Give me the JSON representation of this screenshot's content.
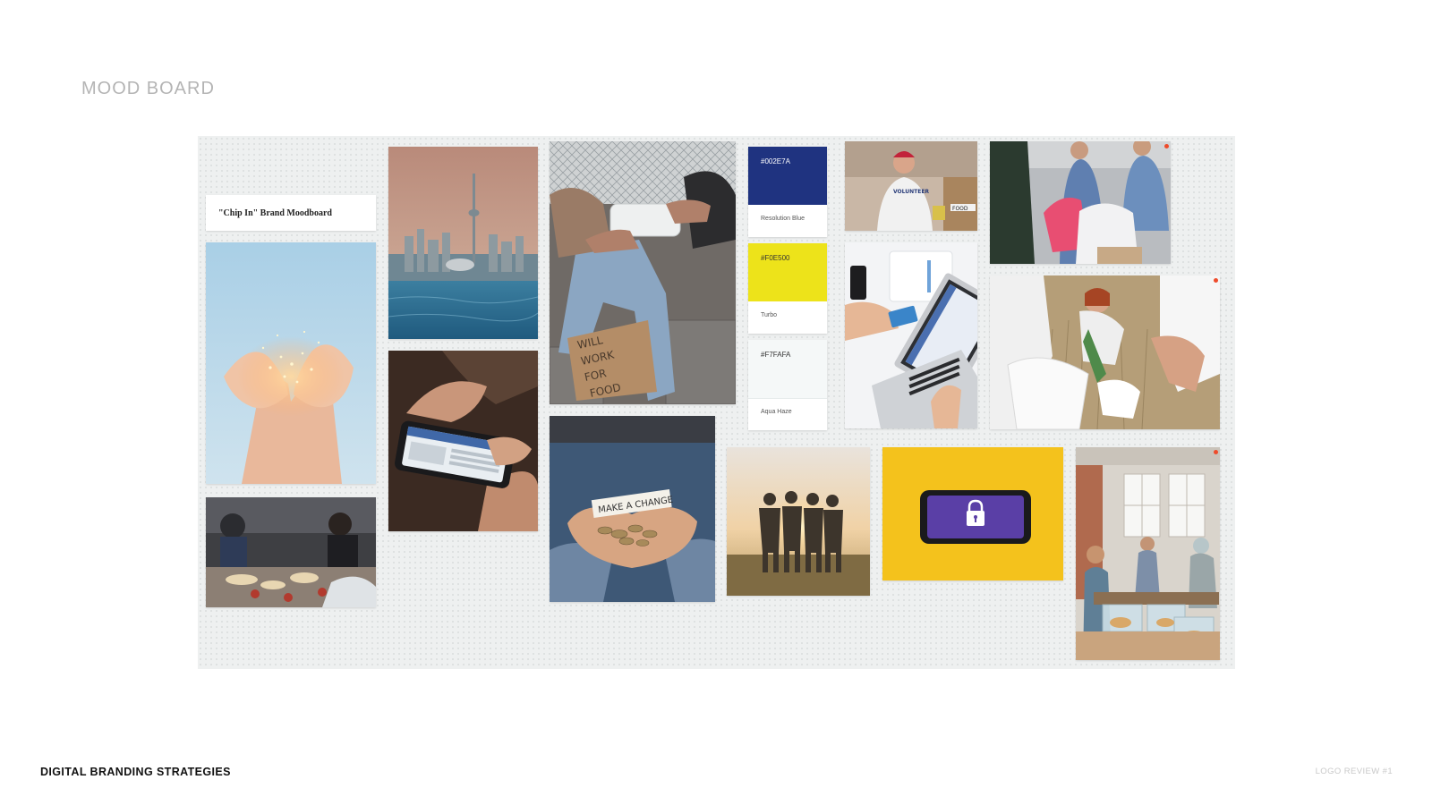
{
  "slide": {
    "title": "MOOD BOARD",
    "footer_left": "DIGITAL BRANDING STRATEGIES",
    "footer_right": "LOGO REVIEW #1"
  },
  "board": {
    "label": "\"Chip In\" Brand Moodboard",
    "palette": [
      {
        "hex": "#002E7A",
        "name": "Resolution Blue",
        "color": "#1f3380",
        "text_color": "#ffffff"
      },
      {
        "hex": "#F0E500",
        "name": "Turbo",
        "color": "#ede31a",
        "text_color": "#333333"
      },
      {
        "hex": "#F7FAFA",
        "name": "Aqua Haze",
        "color": "#f5f8f8",
        "text_color": "#333333"
      }
    ],
    "photos": [
      {
        "subject": "city-skyline"
      },
      {
        "subject": "glowing-hands"
      },
      {
        "subject": "typing-phone"
      },
      {
        "subject": "food-stall"
      },
      {
        "subject": "food-handout"
      },
      {
        "subject": "make-a-change-coins"
      },
      {
        "subject": "volunteer"
      },
      {
        "subject": "card-payment"
      },
      {
        "subject": "volunteers-packing"
      },
      {
        "subject": "cleanup"
      },
      {
        "subject": "friends-sunset"
      },
      {
        "subject": "phone-lock"
      },
      {
        "subject": "food-bank"
      }
    ]
  }
}
